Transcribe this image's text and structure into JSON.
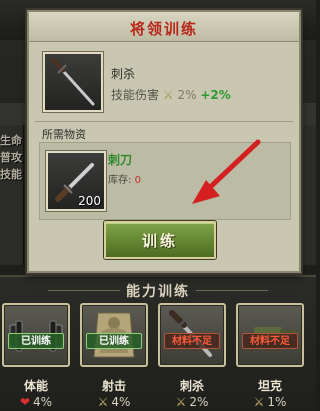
{
  "modal": {
    "title": "将领训练",
    "skill": {
      "name": "刺杀",
      "damage_label": "技能伤害",
      "damage_pct": "2%",
      "damage_bonus": "+2%",
      "icon": "dagger-icon"
    },
    "materials_label": "所需物资",
    "material": {
      "name": "刺刀",
      "quantity": "200",
      "stock_label": "库存:",
      "stock_value": "0",
      "icon": "bayonet-icon"
    },
    "train_button": "训练"
  },
  "background": {
    "stats": [
      "生命",
      "普攻",
      "技能"
    ]
  },
  "ability_section": {
    "title": "能力训练",
    "skills": [
      {
        "name": "体能",
        "value": "4%",
        "badge": "已训练",
        "badge_state": "trained",
        "icon": "dumbbell-icon",
        "value_icon": "heart-icon"
      },
      {
        "name": "射击",
        "value": "4%",
        "badge": "已训练",
        "badge_state": "trained",
        "icon": "target-icon",
        "value_icon": "swords-icon"
      },
      {
        "name": "刺杀",
        "value": "2%",
        "badge": "材料不足",
        "badge_state": "insufficient",
        "icon": "dagger-icon",
        "value_icon": "swords-icon"
      },
      {
        "name": "坦克",
        "value": "1%",
        "badge": "材料不足",
        "badge_state": "insufficient",
        "icon": "tank-icon",
        "value_icon": "swords-icon"
      }
    ]
  },
  "colors": {
    "title_red": "#b8281a",
    "bonus_green": "#2f9a2f",
    "material_green": "#2f8a2a",
    "insufficient_red": "#ff5a3a",
    "button_green": "#6a8f3a",
    "arrow_red": "#d42020"
  }
}
